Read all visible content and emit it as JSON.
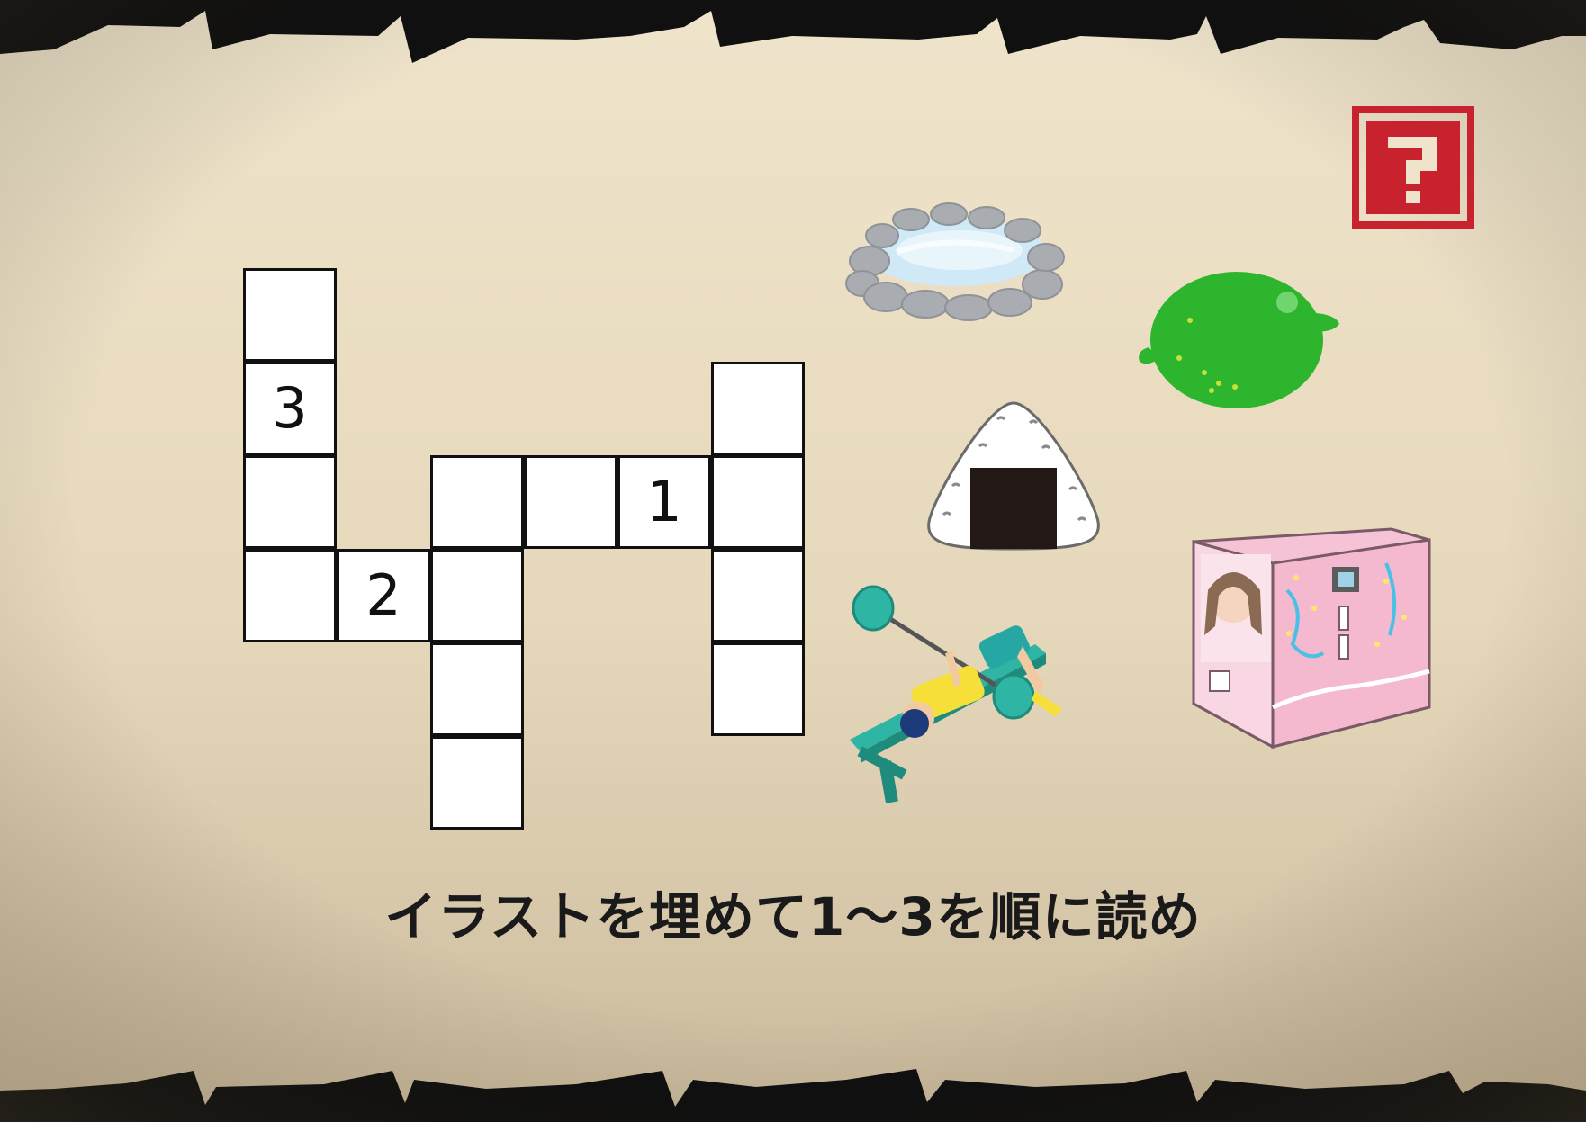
{
  "puzzle": {
    "instruction": "イラストを埋めて1〜3を順に読め",
    "numbers": {
      "one": "1",
      "two": "2",
      "three": "3"
    },
    "colors": {
      "parchment_light": "#f3e9d2",
      "parchment_dark": "#c9b89a",
      "badge_red": "#c8222e"
    },
    "badge_icon": "question-mark-badge-icon",
    "illustrations": [
      {
        "icon": "hot-spring-icon"
      },
      {
        "icon": "lime-icon"
      },
      {
        "icon": "onigiri-icon"
      },
      {
        "icon": "bench-press-icon"
      },
      {
        "icon": "vending-machine-icon"
      }
    ]
  }
}
